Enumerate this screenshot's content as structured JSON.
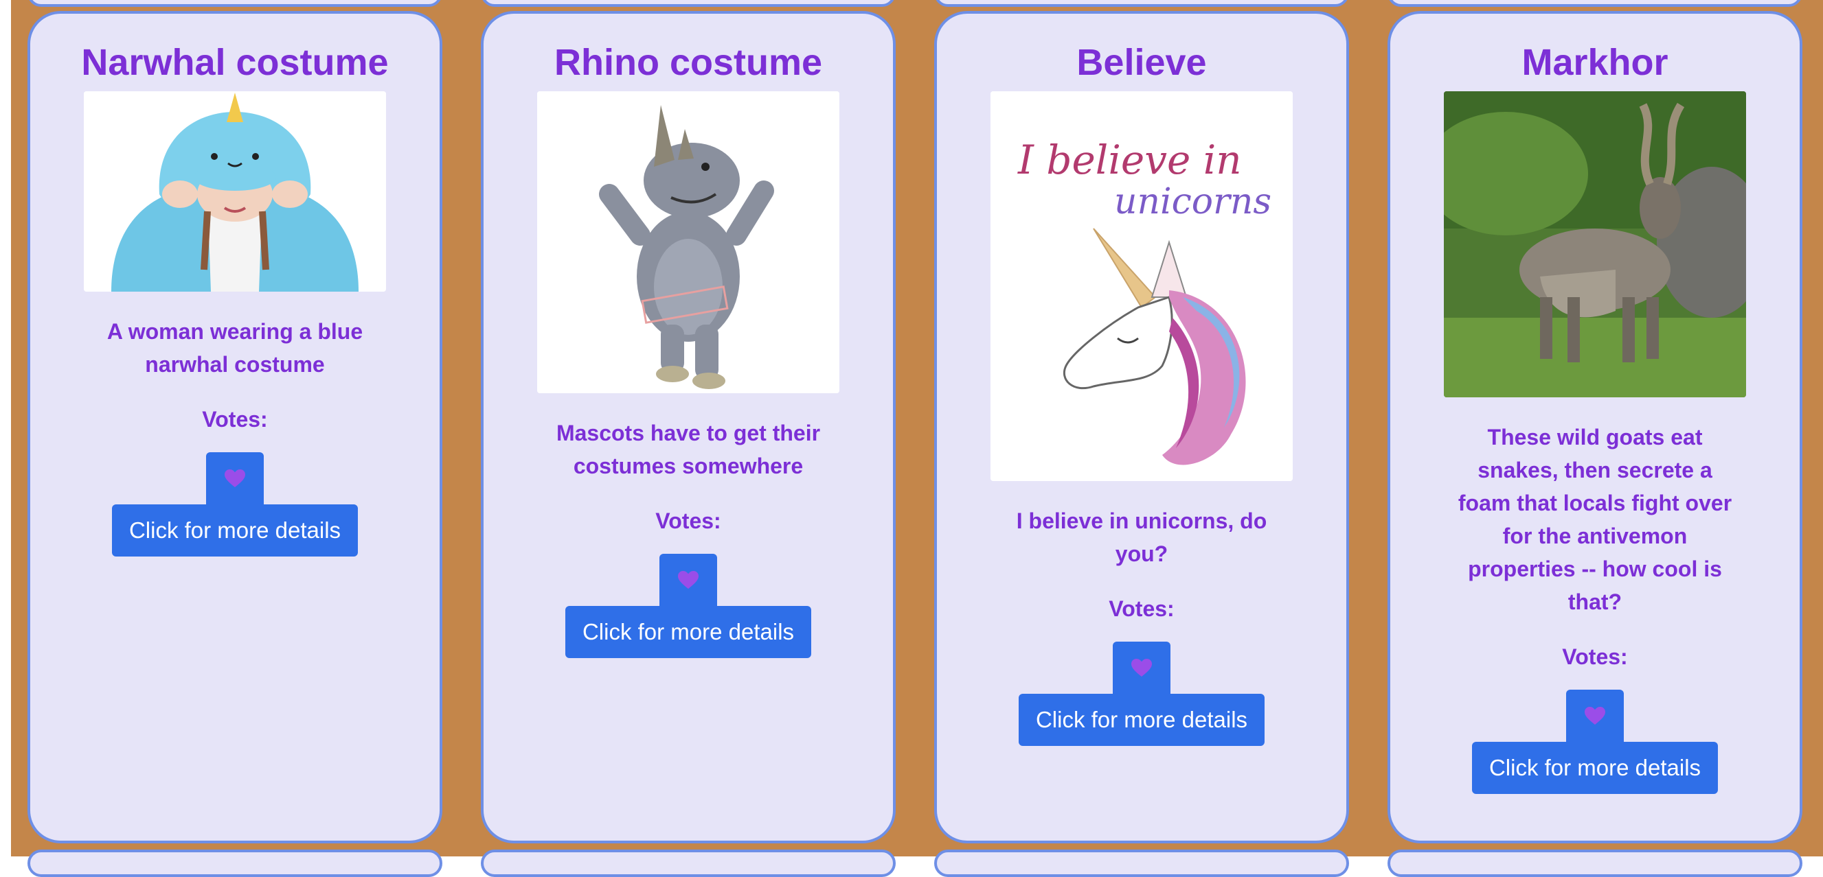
{
  "colors": {
    "page_background": "#c4864a",
    "card_background": "#e6e4f8",
    "card_border": "#6e8fe6",
    "accent_text": "#7c2fd6",
    "button": "#2f6fe8"
  },
  "cards": [
    {
      "title": "Narwhal costume",
      "image": "narwhal-costume-photo",
      "description": "A woman wearing a blue narwhal costume",
      "votes_label": "Votes:",
      "vote_icon": "purple-heart-icon",
      "details_button": "Click for more details"
    },
    {
      "title": "Rhino costume",
      "image": "rhino-mascot-photo",
      "description": "Mascots have to get their costumes somewhere",
      "votes_label": "Votes:",
      "vote_icon": "purple-heart-icon",
      "details_button": "Click for more details"
    },
    {
      "title": "Believe",
      "image": "unicorn-illustration",
      "image_text": "I believe in unicorns",
      "description": "I believe in unicorns, do you?",
      "votes_label": "Votes:",
      "vote_icon": "purple-heart-icon",
      "details_button": "Click for more details"
    },
    {
      "title": "Markhor",
      "image": "markhor-goat-photo",
      "description": "These wild goats eat snakes, then secrete a foam that locals fight over for the antivemon properties -- how cool is that?",
      "votes_label": "Votes:",
      "vote_icon": "purple-heart-icon",
      "details_button": "Click for more details"
    }
  ]
}
